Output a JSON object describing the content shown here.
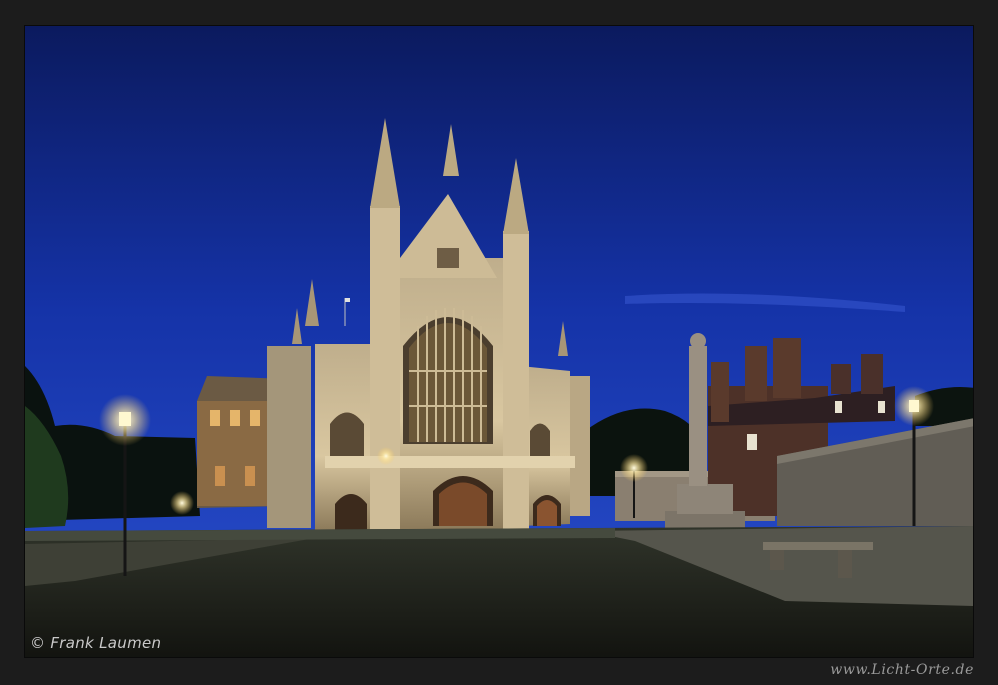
{
  "photo": {
    "copyright": "© Frank Laumen",
    "website": "www.Licht-Orte.de"
  },
  "colors": {
    "frame": "#1c1c1c",
    "sky_top": "#0b1a5e",
    "sky_bottom": "#2547c6",
    "stone_lit": "#d8c8a6",
    "lamp_glow": "#fff2b8",
    "brick": "#5a3a2c",
    "lawn": "#1a1c14"
  }
}
